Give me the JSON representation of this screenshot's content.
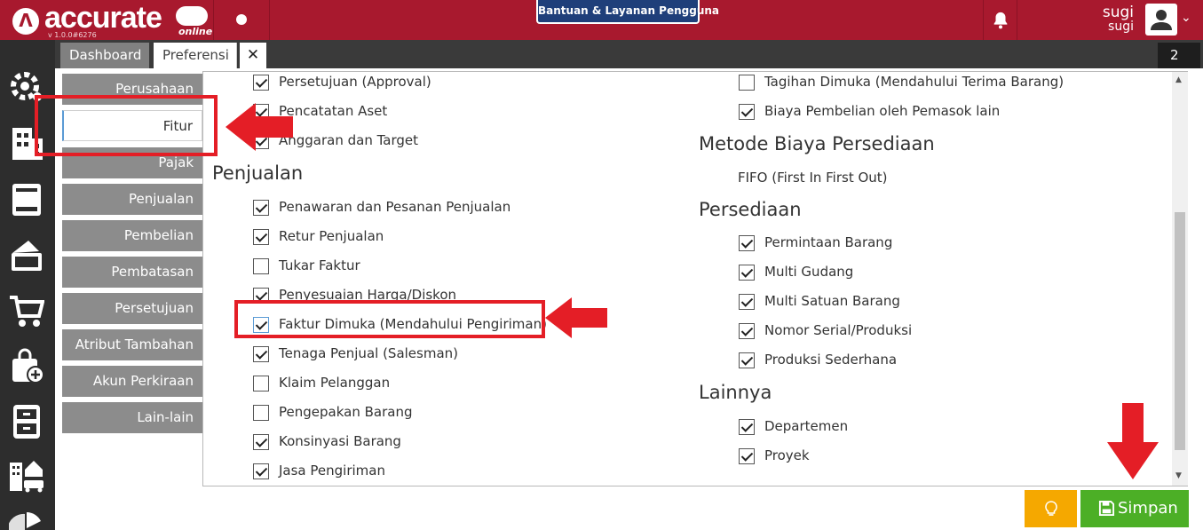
{
  "app": {
    "brand": "accurate",
    "brand_suffix": "online",
    "version": "v 1.0.0#6276",
    "help_label": "Bantuan & Layanan Pengguna",
    "user_name": "sugi",
    "user_sub": "sugi"
  },
  "tabs": {
    "dashboard": "Dashboard",
    "preferensi": "Preferensi",
    "close": "✕",
    "count": "2"
  },
  "menu": {
    "items": [
      "Perusahaan",
      "Fitur",
      "Pajak",
      "Penjualan",
      "Pembelian",
      "Pembatasan",
      "Persetujuan",
      "Atribut Tambahan",
      "Akun Perkiraan",
      "Lain-lain"
    ],
    "active": "Fitur"
  },
  "left_column": {
    "top_items": [
      {
        "label": "Persetujuan (Approval)",
        "checked": true
      },
      {
        "label": "Pencatatan Aset",
        "checked": true
      },
      {
        "label": "Anggaran dan Target",
        "checked": true
      }
    ],
    "penjualan_heading": "Penjualan",
    "penjualan_items": [
      {
        "label": "Penawaran dan Pesanan Penjualan",
        "checked": true
      },
      {
        "label": "Retur Penjualan",
        "checked": true
      },
      {
        "label": "Tukar Faktur",
        "checked": false
      },
      {
        "label": "Penyesuaian Harga/Diskon",
        "checked": true
      },
      {
        "label": "Faktur Dimuka (Mendahului Pengiriman)",
        "checked": true
      },
      {
        "label": "Tenaga Penjual (Salesman)",
        "checked": true
      },
      {
        "label": "Klaim Pelanggan",
        "checked": false
      },
      {
        "label": "Pengepakan Barang",
        "checked": false
      },
      {
        "label": "Konsinyasi Barang",
        "checked": true
      },
      {
        "label": "Jasa Pengiriman",
        "checked": true
      }
    ]
  },
  "right_column": {
    "top_items": [
      {
        "label": "Tagihan Dimuka (Mendahului Terima Barang)",
        "checked": false
      },
      {
        "label": "Biaya Pembelian oleh Pemasok lain",
        "checked": true
      }
    ],
    "metode_heading": "Metode Biaya Persediaan",
    "metode_value": "FIFO (First In First Out)",
    "persediaan_heading": "Persediaan",
    "persediaan_items": [
      {
        "label": "Permintaan Barang",
        "checked": true
      },
      {
        "label": "Multi Gudang",
        "checked": true
      },
      {
        "label": "Multi Satuan Barang",
        "checked": true
      },
      {
        "label": "Nomor Serial/Produksi",
        "checked": true
      },
      {
        "label": "Produksi Sederhana",
        "checked": true
      }
    ],
    "lainnya_heading": "Lainnya",
    "lainnya_items": [
      {
        "label": "Departemen",
        "checked": true
      },
      {
        "label": "Proyek",
        "checked": true
      }
    ]
  },
  "buttons": {
    "save": "Simpan"
  },
  "colors": {
    "brand": "#a8192e",
    "sidebar": "#2d2d2d",
    "menu": "#8c8c8c",
    "save": "#4caf26",
    "tip": "#f5a800",
    "annotation": "#e41e26"
  }
}
